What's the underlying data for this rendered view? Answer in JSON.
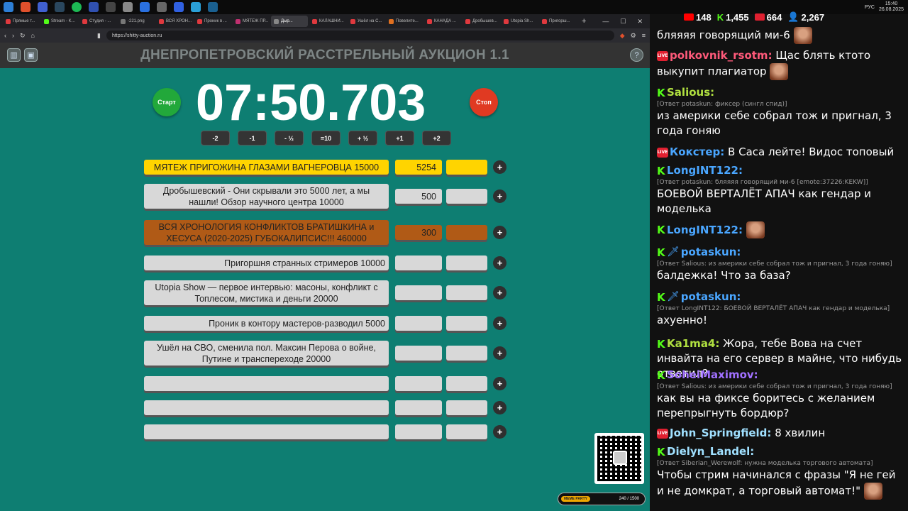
{
  "taskbar": {
    "time": "15:40",
    "date": "26.08.2025",
    "lang": "РУС"
  },
  "tabs": [
    {
      "label": "Прямые т...",
      "color": "#e0393e"
    },
    {
      "label": "Stream - K...",
      "color": "#53fc18"
    },
    {
      "label": "Студия - ...",
      "color": "#e0393e"
    },
    {
      "label": "-221.png",
      "color": "#777777"
    },
    {
      "label": "ВСЯ ХРОН...",
      "color": "#e0393e"
    },
    {
      "label": "Проник в ...",
      "color": "#e0393e"
    },
    {
      "label": "МЯТЕЖ ПР...",
      "color": "#c03070"
    },
    {
      "label": "Дыр...",
      "color": "#888888",
      "active": true
    },
    {
      "label": "КАЛАШНИ...",
      "color": "#e0393e"
    },
    {
      "label": "Ушёл на С...",
      "color": "#e0393e"
    },
    {
      "label": "Повелите...",
      "color": "#e07020"
    },
    {
      "label": "КАНАДА ...",
      "color": "#e0393e"
    },
    {
      "label": "Дробышев...",
      "color": "#e0393e"
    },
    {
      "label": "Utopia Sh...",
      "color": "#e0393e"
    },
    {
      "label": "Пригорш...",
      "color": "#e0393e"
    }
  ],
  "address": "https://shitty-auction.ru",
  "app": {
    "title": "ДНЕПРОПЕТРОВСКИЙ РАССТРЕЛЬНЫЙ АУКЦИОН 1.1",
    "start_label": "Старт",
    "stop_label": "Стоп",
    "timer": "07:50.703",
    "adjust": [
      "-2",
      "-1",
      "- ½",
      "=10",
      "+ ½",
      "+1",
      "+2"
    ]
  },
  "lots": [
    {
      "name": "МЯТЕЖ ПРИГОЖИНА ГЛАЗАМИ ВАГНЕРОВЦА 15000",
      "sum": "5254",
      "style": "gold"
    },
    {
      "name": "Дробышевский - Они скрывали это 5000 лет, а мы нашли! Обзор научного центра 10000",
      "sum": "500",
      "style": "plain"
    },
    {
      "name": "ВСЯ ХРОНОЛОГИЯ КОНФЛИКТОВ БРАТИШКИНА и ХЕСУСА (2020-2025) ГУБОКАЛИПСИС!!! 460000",
      "sum": "300",
      "style": "brown"
    },
    {
      "name": "Пригоршня странных стримеров 10000",
      "sum": "",
      "style": "plain"
    },
    {
      "name": "Utopia Show — первое интервью: масоны, конфликт с Топлесом, мистика и деньги 20000",
      "sum": "",
      "style": "plain"
    },
    {
      "name": "Проник в контору мастеров-разводил 5000",
      "sum": "",
      "style": "plain"
    },
    {
      "name": "Ушёл на СВО, сменила пол. Максин Перова о войне, Путине и трансперeходе 20000",
      "sum": "",
      "style": "plain"
    },
    {
      "name": "",
      "sum": "",
      "style": "plain"
    },
    {
      "name": "",
      "sum": "",
      "style": "plain"
    },
    {
      "name": "",
      "sum": "",
      "style": "plain"
    }
  ],
  "meme": {
    "badge": "MEME PARTY",
    "progress": "240 / 1500"
  },
  "chat": {
    "stats": {
      "youtube": "148",
      "kick": "1,455",
      "live": "664",
      "viewers": "2,267"
    },
    "messages": [
      {
        "user": "",
        "text": "бляяяя говорящий ми-6",
        "color": "#ffffff",
        "emote": true
      },
      {
        "user": "polkovnik_rsotm:",
        "text": "Щас блять ктото выкупит плагиатор",
        "color": "#ff5a7a",
        "platform": "live",
        "emote": true
      },
      {
        "user": "Salious:",
        "reply": "[Ответ potaskun: фиксер (сингл спид)]",
        "text": "из америки себе собрал тож и пригнал, 3 года гоняю",
        "color": "#b0e040",
        "platform": "kick"
      },
      {
        "user": "Кокстер:",
        "text": "В Саса лейте! Видос топовый",
        "color": "#4aa6ff",
        "platform": "live"
      },
      {
        "user": "LongINT122:",
        "reply": "[Ответ potaskun: бляяяя говорящий ми-6 [emote:37226:KEKW]]",
        "text": "БОЕВОЙ ВЕРТАЛЁТ АПАЧ как гендар и моделька",
        "color": "#4aa6ff",
        "platform": "kick"
      },
      {
        "user": "LongINT122:",
        "text": "",
        "color": "#4aa6ff",
        "platform": "kick",
        "emote": true
      },
      {
        "user": "potaskun:",
        "reply": "[Ответ Salious: из америки себе собрал тож и пригнал, 3 года гоняю]",
        "text": "балдежка! Что за база?",
        "color": "#4aa6ff",
        "platform": "kick",
        "mod": true
      },
      {
        "user": "potaskun:",
        "reply": "[Ответ LongINT122: БОЕВОЙ ВЕРТАЛЁТ АПАЧ как гендар и моделька]",
        "text": "ахуенно!",
        "color": "#4aa6ff",
        "platform": "kick",
        "mod": true
      },
      {
        "user": "Ka1ma4:",
        "text": "Жора, тебе Вова на счет инвайта на его сервер в майне, что нибудь ответил?",
        "color": "#b0e040",
        "platform": "kick"
      },
      {
        "user": "SoheiMaximov:",
        "reply": "[Ответ Salious: из америки себе собрал тож и пригнал, 3 года гоняю]",
        "text": "как вы на фиксе боритесь с желанием перепрыгнуть бордюр?",
        "color": "#a070ff",
        "platform": "kick"
      },
      {
        "user": "John_Springfield:",
        "text": "8 хвилин",
        "color": "#a0e0ff",
        "platform": "live"
      },
      {
        "user": "Dielyn_Landel:",
        "reply": "[Ответ Siberian_Werewolf: нужна моделька торгового автомата]",
        "text": "Чтобы стрим начинался с фразы \"Я не гей и не домкрат, а торговый автомат!\"",
        "color": "#a0e0ff",
        "platform": "kick",
        "emote": true
      }
    ]
  }
}
